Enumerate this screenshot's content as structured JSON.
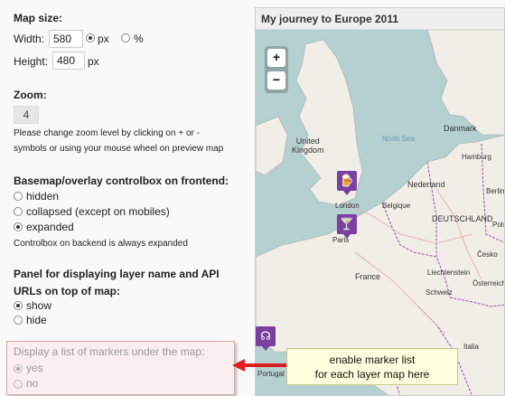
{
  "map_size": {
    "heading": "Map size:",
    "width_label": "Width:",
    "width_value": "580",
    "unit_px": "px",
    "unit_percent": "%",
    "height_label": "Height:",
    "height_value": "480",
    "height_unit": "px"
  },
  "zoom": {
    "heading": "Zoom:",
    "value": "4",
    "help_line1": "Please change zoom level by clicking on + or -",
    "help_line2": "symbols or using your mouse wheel on preview map"
  },
  "controlbox": {
    "heading": "Basemap/overlay controlbox on frontend:",
    "options": [
      "hidden",
      "collapsed (except on mobiles)",
      "expanded"
    ],
    "selected": "expanded",
    "note": "Controlbox on backend is always expanded"
  },
  "panel": {
    "heading_line1": "Panel for displaying layer name and API",
    "heading_line2": "URLs on top of map:",
    "options": [
      "show",
      "hide"
    ],
    "selected": "show"
  },
  "markers_list": {
    "heading": "Display a list of markers under the map:",
    "options": [
      "yes",
      "no"
    ],
    "selected": "yes",
    "disabled": true
  },
  "callout": {
    "line1": "enable marker list",
    "line2": "for each layer map here",
    "arrow_color": "#e02020"
  },
  "map": {
    "title": "My journey to Europe 2011",
    "zoom_in": "+",
    "zoom_out": "−",
    "marker_color": "#7b3fa0",
    "labels": {
      "denmark": "Danmark",
      "north_sea": "North Sea",
      "united_kingdom": "United\nKingdom",
      "nederland": "Nederland",
      "belgique": "Belgique",
      "deutschland": "DEUTSCHLAND",
      "paris": "Paris",
      "france": "France",
      "london": "London",
      "hamburg": "Hamburg",
      "berlin": "Berlin",
      "polska": "Polska",
      "cesko": "Česko",
      "schweiz": "Schweiz",
      "italia": "Italia",
      "portugal": "Portugal",
      "osterreich": "Österreich",
      "liechtenstein": "Liechtenstein"
    }
  }
}
